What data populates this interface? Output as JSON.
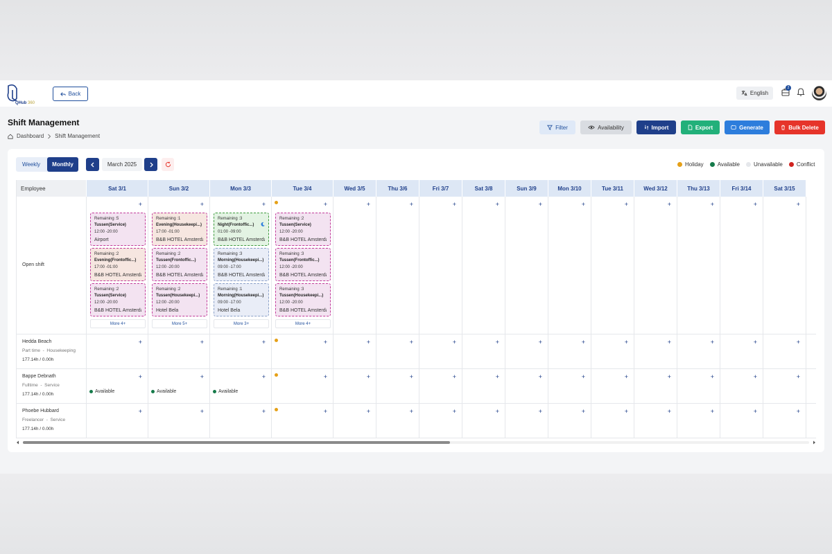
{
  "header": {
    "logo_text": "QHub360",
    "back_label": "Back",
    "language_label": "English",
    "notification_count": "2"
  },
  "page": {
    "title": "Shift Management",
    "breadcrumb": [
      "Dashboard",
      "Shift Management"
    ]
  },
  "actions": {
    "filter": "Filter",
    "availability": "Availability",
    "import": "Import",
    "export": "Export",
    "generate": "Generate",
    "bulk_delete": "Bulk Delete"
  },
  "toolbar": {
    "weekly": "Weekly",
    "monthly": "Monthly",
    "month": "March 2025"
  },
  "legend": [
    {
      "label": "Holiday",
      "color": "#e5a018"
    },
    {
      "label": "Available",
      "color": "#157a4a"
    },
    {
      "label": "Unavailable",
      "color": "#e5e7eb"
    },
    {
      "label": "Conflict",
      "color": "#d0231f"
    }
  ],
  "grid": {
    "employee_header": "Employee",
    "days": [
      "Sat 3/1",
      "Sun 3/2",
      "Mon 3/3",
      "Tue 3/4",
      "Wed 3/5",
      "Thu 3/6",
      "Fri 3/7",
      "Sat 3/8",
      "Sun 3/9",
      "Mon 3/10",
      "Tue 3/11",
      "Wed 3/12",
      "Thu 3/13",
      "Fri 3/14",
      "Sat 3/15"
    ],
    "open_shift_label": "Open shift",
    "open_shifts": [
      {
        "more": "More 4+",
        "shifts": [
          {
            "remaining": "Remaining :5",
            "title": "Tussen(Service)",
            "time": "12:00 -20:00",
            "location": "Airport",
            "bg": "#f3e3f1",
            "border": "#c23a9a"
          },
          {
            "remaining": "Remaining :2",
            "title": "Evening(Frontoffic...)",
            "time": "17:00 -01:00",
            "location": "B&B HOTEL Amsterda...",
            "bg": "#f6e6e0",
            "border": "#c23a9a"
          },
          {
            "remaining": "Remaining :2",
            "title": "Tussen(Service)",
            "time": "12:00 -20:00",
            "location": "B&B HOTEL Amsterda...",
            "bg": "#f3e3f1",
            "border": "#c23a9a"
          }
        ]
      },
      {
        "more": "More 5+",
        "shifts": [
          {
            "remaining": "Remaining :1",
            "title": "Evening(Housekeepi...)",
            "time": "17:00 -01:00",
            "location": "B&B HOTEL Amsterda...",
            "bg": "#f6e6e0",
            "border": "#c23a9a"
          },
          {
            "remaining": "Remaining :2",
            "title": "Tussen(Frontoffic...)",
            "time": "12:00 -20:00",
            "location": "B&B HOTEL Amsterda...",
            "bg": "#f3e3f1",
            "border": "#c23a9a"
          },
          {
            "remaining": "Remaining :2",
            "title": "Tussen(Housekeepi...)",
            "time": "12:00 -20:00",
            "location": "Hotel Bela",
            "bg": "#f3e3f1",
            "border": "#c23a9a"
          }
        ]
      },
      {
        "more": "More 3+",
        "shifts": [
          {
            "remaining": "Remaining :3",
            "title": "Night(Frontoffic...)",
            "time": "01:00 -09:00",
            "location": "B&B HOTEL Amsterda...",
            "bg": "#e3f3e3",
            "border": "#3c9a3c",
            "moon": true
          },
          {
            "remaining": "Remaining :3",
            "title": "Morning(Housekeepi...)",
            "time": "09:00 -17:00",
            "location": "B&B HOTEL Amsterda...",
            "bg": "#e9edf7",
            "border": "#8aa0c8"
          },
          {
            "remaining": "Remaining :1",
            "title": "Morning(Housekeepi...)",
            "time": "09:00 -17:00",
            "location": "Hotel Bela",
            "bg": "#e9edf7",
            "border": "#8aa0c8"
          }
        ]
      },
      {
        "more": "More 4+",
        "shifts": [
          {
            "remaining": "Remaining :2",
            "title": "Tussen(Service)",
            "time": "12:00 -20:00",
            "location": "B&B HOTEL Amsterda...",
            "bg": "#f3e3f1",
            "border": "#c23a9a"
          },
          {
            "remaining": "Remaining :3",
            "title": "Tussen(Frontoffic...)",
            "time": "12:00 -20:00",
            "location": "B&B HOTEL Amsterda...",
            "bg": "#f3e3f1",
            "border": "#c23a9a"
          },
          {
            "remaining": "Remaining :3",
            "title": "Tussen(Housekeepi...)",
            "time": "12:00 -20:00",
            "location": "B&B HOTEL Amsterda...",
            "bg": "#f3e3f1",
            "border": "#c23a9a"
          }
        ]
      }
    ],
    "employees": [
      {
        "name": "Hedda Beach",
        "type": "Part time",
        "dept": "Housekeeping",
        "hours": "177.14h / 0.00h",
        "available_days": []
      },
      {
        "name": "Bappe Debnath",
        "type": "Fulltime",
        "dept": "Service",
        "hours": "177.14h / 0.00h",
        "available_days": [
          0,
          1,
          2
        ],
        "available_label": "Available"
      },
      {
        "name": "Phoebe Hubbard",
        "type": "Freelancer",
        "dept": "Service",
        "hours": "177.14h / 0.00h",
        "available_days": []
      }
    ],
    "holiday_day_index": 3,
    "plus_symbol": "+"
  }
}
